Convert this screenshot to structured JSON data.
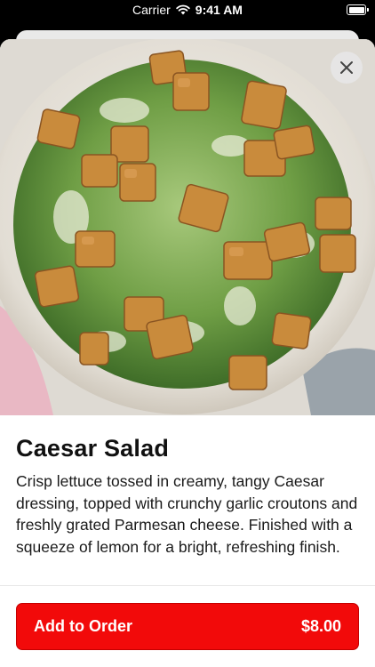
{
  "status_bar": {
    "carrier": "Carrier",
    "time": "9:41 AM"
  },
  "item": {
    "name": "Caesar Salad",
    "description": "Crisp lettuce tossed in creamy, tangy Caesar dressing, topped with crunchy garlic croutons and freshly grated Parmesan cheese. Finished with a squeeze of lemon for a bright, refreshing finish.",
    "image_alt": "Bowl of Caesar salad with croutons"
  },
  "order_button": {
    "label": "Add to Order",
    "price": "$8.00"
  },
  "icons": {
    "close": "close-icon",
    "wifi": "wifi-icon",
    "battery": "battery-icon"
  },
  "colors": {
    "accent": "#f20a0a",
    "background": "#ffffff",
    "text": "#111111"
  }
}
